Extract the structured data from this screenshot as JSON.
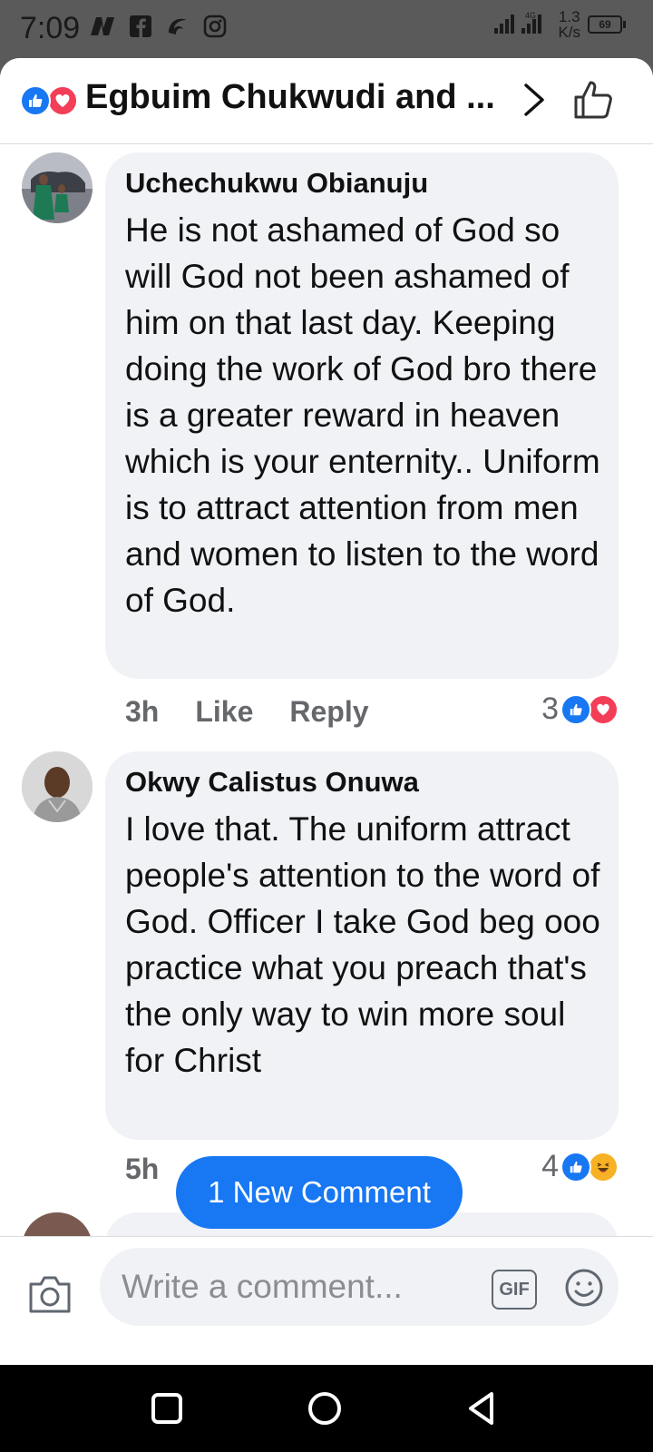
{
  "status_bar": {
    "time": "7:09",
    "network": "4G",
    "speed_value": "1.3",
    "speed_unit": "K/s",
    "battery": "69"
  },
  "header": {
    "title": "Egbuim Chukwudi and ...",
    "reaction_icons": [
      "like-icon",
      "love-icon"
    ]
  },
  "comments": [
    {
      "author": "Uchechukwu Obianuju",
      "text": "He is not ashamed of God so will God not been ashamed of him on that last day. Keeping doing the work of God bro there is a greater reward in heaven which is your enternity.. Uniform is to attract attention from men and women to listen to the word of God.",
      "time": "3h",
      "like_label": "Like",
      "reply_label": "Reply",
      "reaction_count": "3",
      "reactions": [
        "like-icon",
        "love-icon"
      ]
    },
    {
      "author": "Okwy Calistus Onuwa",
      "text": "I love that. The uniform attract people's attention to the word of God. Officer I take God beg ooo practice what you preach that's the only way to win more soul for Christ",
      "time": "5h",
      "reaction_count": "4",
      "reactions": [
        "like-icon",
        "haha-icon"
      ]
    }
  ],
  "new_comment_pill": "1 New Comment",
  "composer": {
    "placeholder": "Write a comment...",
    "gif_label": "GIF"
  },
  "colors": {
    "accent": "#1877f2",
    "love": "#f33e58",
    "haha": "#f7b125",
    "bubble": "#f0f2f5",
    "meta": "#65676b"
  }
}
